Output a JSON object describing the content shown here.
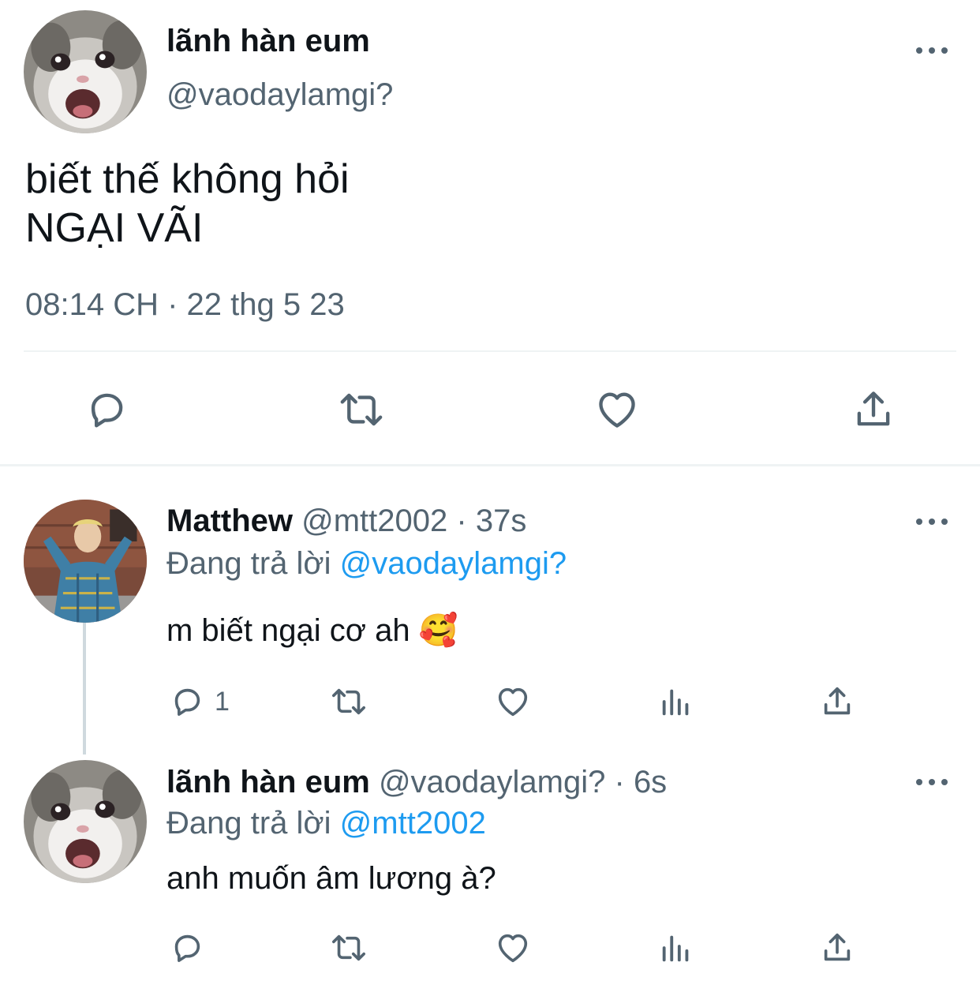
{
  "main_tweet": {
    "display_name": "lãnh hàn eum",
    "handle": "@vaodaylamgi?",
    "text_line1": "biết thế không hỏi",
    "text_line2": "NGẠI VÃI",
    "timestamp": "08:14 CH · 22 thg 5 23",
    "actions": [
      "reply-icon",
      "retweet-icon",
      "like-icon",
      "share-icon"
    ]
  },
  "reply1": {
    "display_name": "Matthew",
    "handle": "@mtt2002",
    "separator": "·",
    "time": "37s",
    "replying_prefix": "Đang trả lời",
    "replying_to": "@vaodaylamgi?",
    "text": "m biết ngại cơ ah",
    "emoji": "🥰",
    "reply_count": "1"
  },
  "reply2": {
    "display_name": "lãnh hàn eum",
    "handle": "@vaodaylamgi?",
    "separator": "·",
    "time": "6s",
    "replying_prefix": "Đang trả lời",
    "replying_to": "@mtt2002",
    "text": "anh muốn âm lương à?"
  },
  "colors": {
    "text": "#0f1419",
    "secondary": "#536471",
    "link": "#1d9bf0",
    "divider": "#eff3f4"
  }
}
